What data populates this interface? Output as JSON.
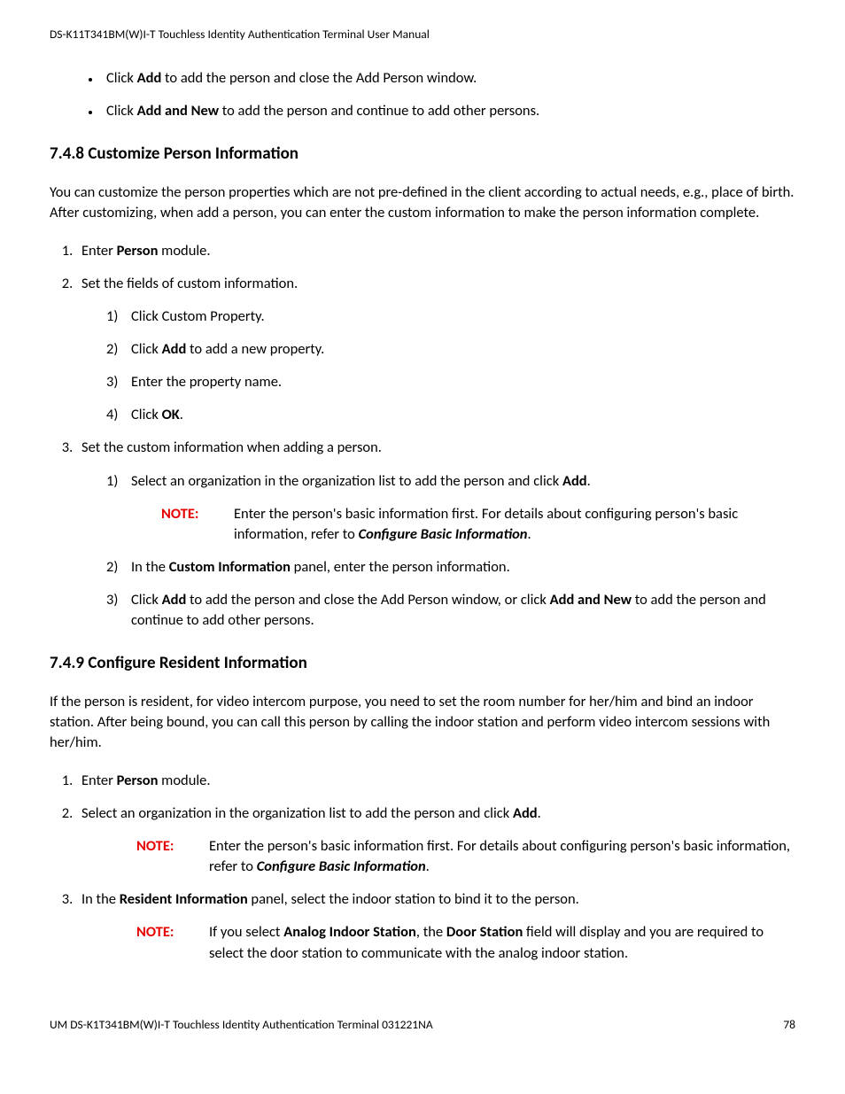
{
  "header": "DS-K11T341BM(W)I-T Touchless Identity Authentication Terminal User Manual",
  "intro_bullets": {
    "b1_pre": "Click ",
    "b1_bold": "Add",
    "b1_post": " to add the person and close the Add Person window.",
    "b2_pre": "Click ",
    "b2_bold": "Add and New",
    "b2_post": " to add the person and continue to add other persons."
  },
  "section748": {
    "heading": "7.4.8 Customize Person Information",
    "desc": "You can customize the person properties which are not pre-defined in the client according to actual needs, e.g., place of birth. After customizing, when add a person, you can enter the custom information to make the person information complete.",
    "step1_pre": "Enter ",
    "step1_bold": "Person",
    "step1_post": " module.",
    "step2": "Set the fields of custom information.",
    "step2_sub1": "Click Custom Property.",
    "step2_sub2_pre": "Click ",
    "step2_sub2_bold": "Add",
    "step2_sub2_post": " to add a new property.",
    "step2_sub3": "Enter the property name.",
    "step2_sub4_pre": "Click ",
    "step2_sub4_bold": "OK",
    "step2_sub4_post": ".",
    "step3": "Set the custom information when adding a person.",
    "step3_sub1_pre": "Select an organization in the organization list to add the person and click ",
    "step3_sub1_bold": "Add",
    "step3_sub1_post": ".",
    "note1_label": "NOTE:",
    "note1_text_pre": "Enter the person's basic information first. For details about configuring person's basic information, refer to ",
    "note1_text_bold": "Configure Basic Information",
    "note1_text_post": ".",
    "step3_sub2_pre": "In the ",
    "step3_sub2_bold": "Custom Information",
    "step3_sub2_post": " panel, enter the person information.",
    "step3_sub3_pre": "Click ",
    "step3_sub3_bold1": "Add",
    "step3_sub3_mid": " to add the person and close the Add Person window, or click ",
    "step3_sub3_bold2": "Add and New",
    "step3_sub3_post": " to add the person and continue to add other persons."
  },
  "section749": {
    "heading": "7.4.9 Configure Resident Information",
    "desc": "If the person is resident, for video intercom purpose, you need to set the room number for her/him and bind an indoor station. After being bound, you can call this person by calling the indoor station and perform video intercom sessions with her/him.",
    "step1_pre": "Enter ",
    "step1_bold": "Person",
    "step1_post": " module.",
    "step2_pre": "Select an organization in the organization list to add the person and click ",
    "step2_bold": "Add",
    "step2_post": ".",
    "note1_label": "NOTE:",
    "note1_text_pre": "Enter the person's basic information first. For details about configuring person's basic information, refer to ",
    "note1_text_bold": "Configure Basic Information",
    "note1_text_post": ".",
    "step3_pre": "In the ",
    "step3_bold": "Resident Information",
    "step3_post": " panel, select the indoor station to bind it to the person.",
    "note2_label": "NOTE:",
    "note2_pre": "If you select ",
    "note2_bold1": "Analog Indoor Station",
    "note2_mid": ", the ",
    "note2_bold2": "Door Station",
    "note2_post": " field will display and you are required to select the door station to communicate with the analog indoor station."
  },
  "footer": {
    "left": "UM DS-K1T341BM(W)I-T Touchless Identity Authentication Terminal 031221NA",
    "right": "78"
  }
}
